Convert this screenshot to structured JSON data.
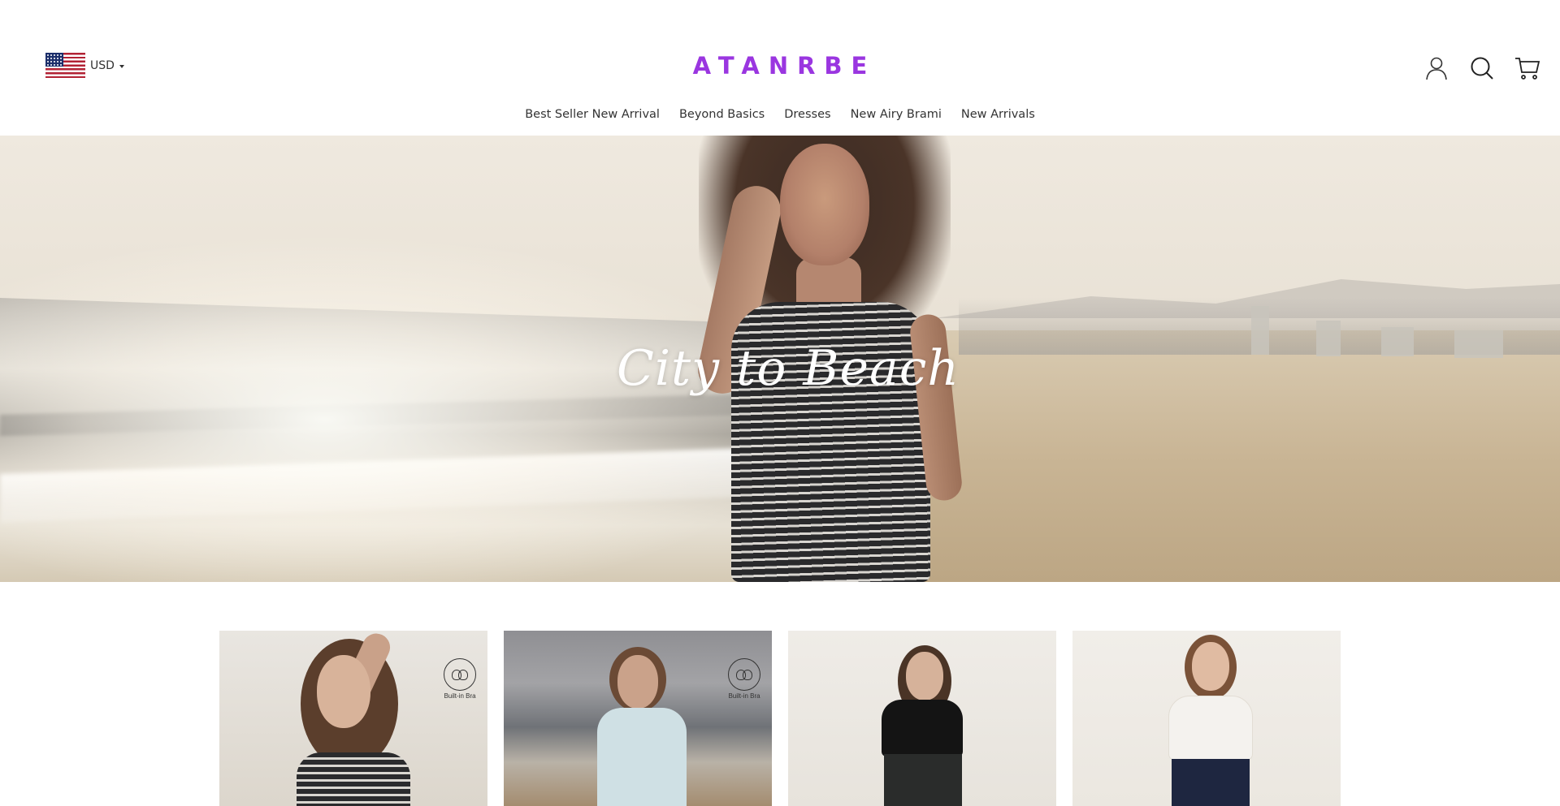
{
  "header": {
    "currency": {
      "code": "USD",
      "flag_icon": "us-flag-icon"
    },
    "logo_text": "ATANRBE",
    "brand_color": "#9a36e0",
    "icons": [
      "account-icon",
      "search-icon",
      "cart-icon"
    ]
  },
  "nav": {
    "items": [
      {
        "label": "Best Seller New Arrival"
      },
      {
        "label": "Beyond Basics"
      },
      {
        "label": "Dresses"
      },
      {
        "label": "New Airy Brami"
      },
      {
        "label": "New Arrivals"
      }
    ]
  },
  "hero": {
    "title": "City to Beach"
  },
  "products": [
    {
      "badge": "Built-in Bra"
    },
    {
      "badge": "Built-in Bra"
    },
    {
      "badge": ""
    },
    {
      "badge": ""
    }
  ]
}
